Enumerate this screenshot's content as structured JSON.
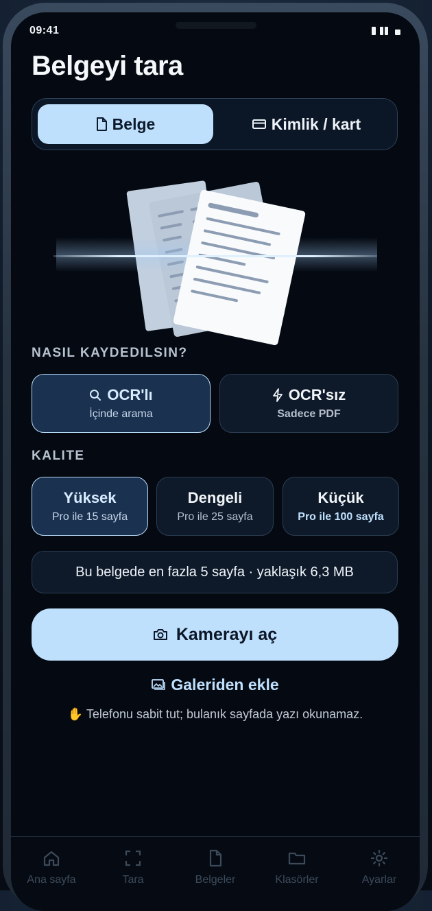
{
  "status": {
    "time": "09:41"
  },
  "page": {
    "title": "Belgeyi tara"
  },
  "mode_tabs": [
    {
      "label": "Belge",
      "icon": "document-icon",
      "active": true
    },
    {
      "label": "Kimlik / kart",
      "icon": "id-card-icon",
      "active": false
    }
  ],
  "save_section": {
    "label": "NASIL KAYDEDILSIN?",
    "options": [
      {
        "title": "OCR'lı",
        "subtitle": "İçinde arama",
        "icon": "search-icon",
        "selected": true
      },
      {
        "title": "OCR'sız",
        "subtitle": "Sadece PDF",
        "icon": "lightning-icon",
        "selected": false
      }
    ]
  },
  "quality_section": {
    "label": "KALITE",
    "options": [
      {
        "title": "Yüksek",
        "subtitle": "Pro ile 15 sayfa",
        "selected": true
      },
      {
        "title": "Dengeli",
        "subtitle": "Pro ile 25 sayfa",
        "selected": false
      },
      {
        "title": "Küçük",
        "subtitle": "Pro ile 100 sayfa",
        "selected": false
      }
    ]
  },
  "info": {
    "text": "Bu belgede en fazla 5 sayfa · yaklaşık 6,3 MB"
  },
  "actions": {
    "camera_label": "Kamerayı aç",
    "camera_icon": "camera-icon",
    "gallery_label": "Galeriden ekle",
    "gallery_icon": "gallery-icon"
  },
  "hint": {
    "text": "✋ Telefonu sabit tut; bulanık sayfada yazı okunamaz."
  },
  "tabbar": [
    {
      "label": "Ana sayfa",
      "icon": "home-icon"
    },
    {
      "label": "Tara",
      "icon": "scan-icon"
    },
    {
      "label": "Belgeler",
      "icon": "document-icon"
    },
    {
      "label": "Klasörler",
      "icon": "folder-icon"
    },
    {
      "label": "Ayarlar",
      "icon": "gear-icon"
    }
  ],
  "colors": {
    "accent": "#bfe0fd",
    "background": "#050a12",
    "card": "#0e1a2a",
    "selected_card": "#1b3150"
  }
}
